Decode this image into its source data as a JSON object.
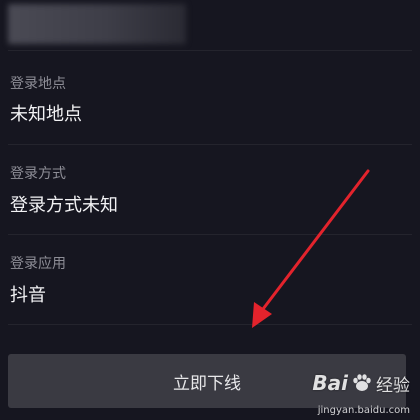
{
  "fields": [
    {
      "label": "登录地点",
      "value": "未知地点"
    },
    {
      "label": "登录方式",
      "value": "登录方式未知"
    },
    {
      "label": "登录应用",
      "value": "抖音"
    }
  ],
  "action": {
    "offline_label": "立即下线"
  },
  "annotation": {
    "arrow_color": "#e3232c"
  },
  "watermark": {
    "brand_prefix": "Bai",
    "brand_suffix": "经验",
    "url": "jingyan.baidu.com"
  },
  "colors": {
    "background": "#161620",
    "label": "#8d8d96",
    "value": "#f2f2f4",
    "button_bg": "#3a3a42"
  }
}
